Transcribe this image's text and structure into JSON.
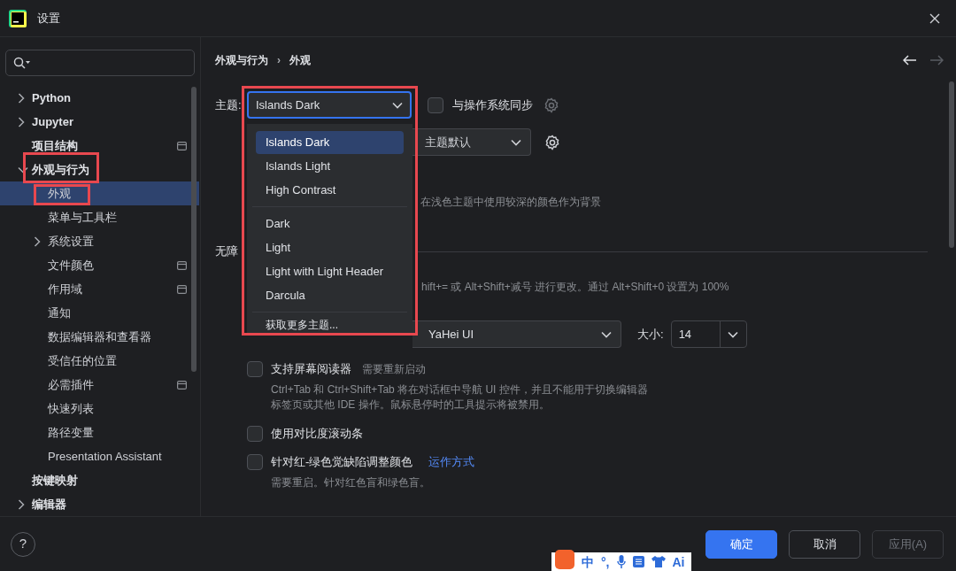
{
  "window": {
    "title": "设置"
  },
  "sidebar": {
    "items": [
      {
        "label": "Python",
        "expandable": true,
        "expanded": false,
        "selected": false,
        "badge": false
      },
      {
        "label": "Jupyter",
        "expandable": true,
        "expanded": false,
        "selected": false,
        "badge": false
      },
      {
        "label": "项目结构",
        "expandable": false,
        "selected": false,
        "badge": true
      },
      {
        "label": "外观与行为",
        "expandable": true,
        "expanded": true,
        "selected": false,
        "badge": false,
        "children": [
          {
            "label": "外观",
            "expandable": false,
            "selected": true,
            "badge": false
          },
          {
            "label": "菜单与工具栏",
            "expandable": false,
            "selected": false,
            "badge": false
          },
          {
            "label": "系统设置",
            "expandable": true,
            "expanded": false,
            "selected": false,
            "badge": false
          },
          {
            "label": "文件颜色",
            "expandable": false,
            "selected": false,
            "badge": true
          },
          {
            "label": "作用域",
            "expandable": false,
            "selected": false,
            "badge": true
          },
          {
            "label": "通知",
            "expandable": false,
            "selected": false,
            "badge": false
          },
          {
            "label": "数据编辑器和查看器",
            "expandable": false,
            "selected": false,
            "badge": false
          },
          {
            "label": "受信任的位置",
            "expandable": false,
            "selected": false,
            "badge": false
          },
          {
            "label": "必需插件",
            "expandable": false,
            "selected": false,
            "badge": true
          },
          {
            "label": "快速列表",
            "expandable": false,
            "selected": false,
            "badge": false
          },
          {
            "label": "路径变量",
            "expandable": false,
            "selected": false,
            "badge": false
          },
          {
            "label": "Presentation Assistant",
            "expandable": false,
            "selected": false,
            "badge": false
          }
        ]
      },
      {
        "label": "按键映射",
        "expandable": false,
        "selected": false,
        "badge": false
      },
      {
        "label": "编辑器",
        "expandable": true,
        "expanded": false,
        "selected": false,
        "badge": false
      }
    ]
  },
  "breadcrumb": {
    "items": [
      "外观与行为",
      "外观"
    ],
    "separator": "›"
  },
  "theme": {
    "label": "主题:",
    "value": "Islands Dark",
    "focused": true
  },
  "sync_os": {
    "label": "与操作系统同步",
    "checked": false
  },
  "theme_popup": {
    "groups": [
      [
        {
          "label": "Islands Dark",
          "selected": true
        },
        {
          "label": "Islands Light",
          "selected": false
        },
        {
          "label": "High Contrast",
          "selected": false
        }
      ],
      [
        {
          "label": "Dark",
          "selected": false
        },
        {
          "label": "Light",
          "selected": false
        },
        {
          "label": "Light with Light Header",
          "selected": false
        },
        {
          "label": "Darcula",
          "selected": false
        }
      ]
    ],
    "more": "获取更多主题..."
  },
  "editor_scheme": {
    "value": "主题默认"
  },
  "dark_bg_note": "在浅色主题中使用较深的颜色作为背景",
  "section": "无障",
  "zoom_note": "hift+= 或 Alt+Shift+减号 进行更改。通过 Alt+Shift+0 设置为 100%",
  "font": {
    "value": "YaHei UI",
    "size_label": "大小:",
    "size": "14"
  },
  "options": [
    {
      "label": "支持屏幕阅读器",
      "hint": "需要重新启动",
      "note_lines": [
        "Ctrl+Tab 和 Ctrl+Shift+Tab 将在对话框中导航 UI 控件，并且不能用于切换编辑器",
        "标签页或其他 IDE 操作。鼠标悬停时的工具提示将被禁用。"
      ],
      "checked": false
    },
    {
      "label": "使用对比度滚动条",
      "checked": false
    },
    {
      "label": "针对红-绿色觉缺陷调整颜色",
      "link": "运作方式",
      "note_lines": [
        "需要重启。针对红色盲和绿色盲。"
      ],
      "checked": false
    }
  ],
  "help": "?",
  "buttons": [
    {
      "label": "确定",
      "kind": "primary"
    },
    {
      "label": "取消",
      "kind": "secondary"
    },
    {
      "label": "应用(A)",
      "kind": "disabled"
    }
  ],
  "ime": {
    "items": [
      {
        "kind": "text",
        "label": "中"
      },
      {
        "kind": "text",
        "label": "°,"
      },
      {
        "kind": "mic"
      },
      {
        "kind": "keyboard"
      },
      {
        "kind": "shirt"
      },
      {
        "kind": "text",
        "label": "Ai"
      }
    ]
  }
}
